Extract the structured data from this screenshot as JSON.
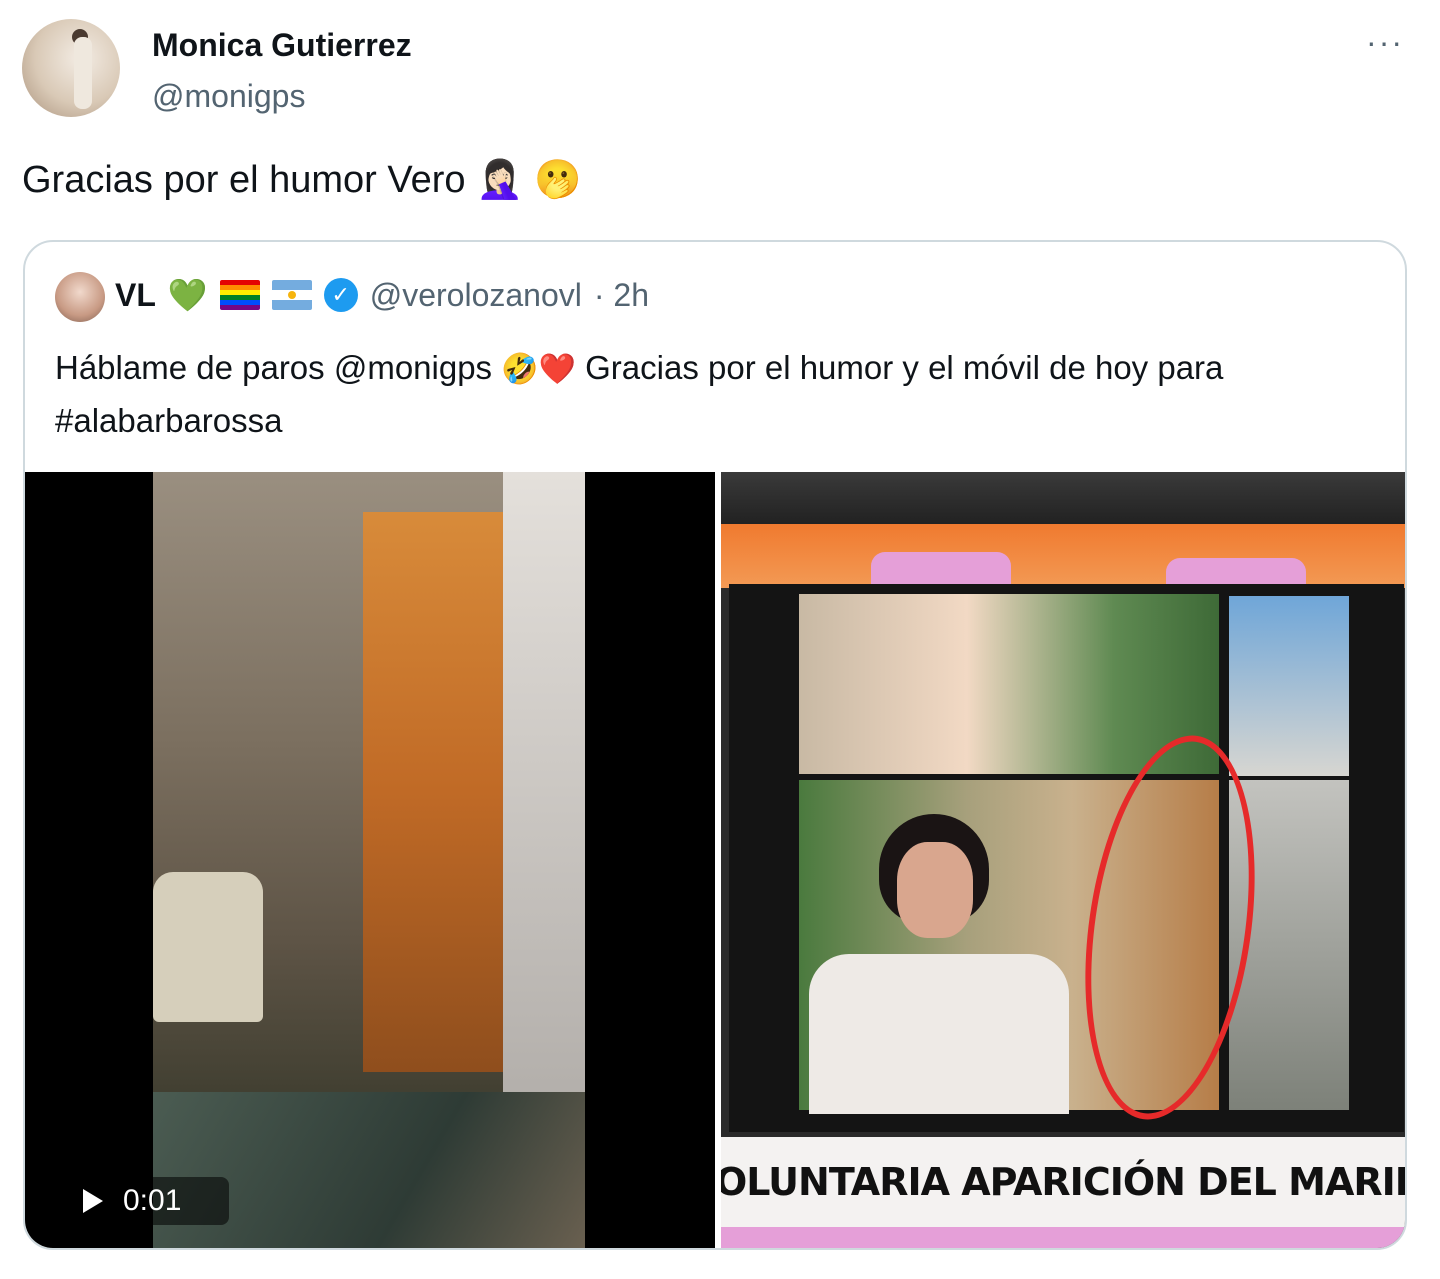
{
  "post": {
    "author_name": "Monica Gutierrez",
    "author_handle": "@monigps",
    "more_label": "···",
    "text": "Gracias por el humor Vero 🤦🏻‍♀️ 🫢"
  },
  "quote": {
    "author_name": "VL",
    "badges": [
      "💚"
    ],
    "author_handle": "@verolozanovl",
    "time": "· 2h",
    "verified_glyph": "✓",
    "text_part1": "Háblame de paros @monigps ",
    "emojis": "🤣❤️",
    "text_part2": " Gracias por el humor y el móvil de hoy para #alabarbarossa"
  },
  "media": {
    "video_time": "0:01",
    "banner_text": "OLUNTARIA APARICIÓN DEL MARIDO DE"
  },
  "colors": {
    "verified": "#1d9bf0",
    "secondary_text": "#536471",
    "border": "#cfd9de"
  }
}
